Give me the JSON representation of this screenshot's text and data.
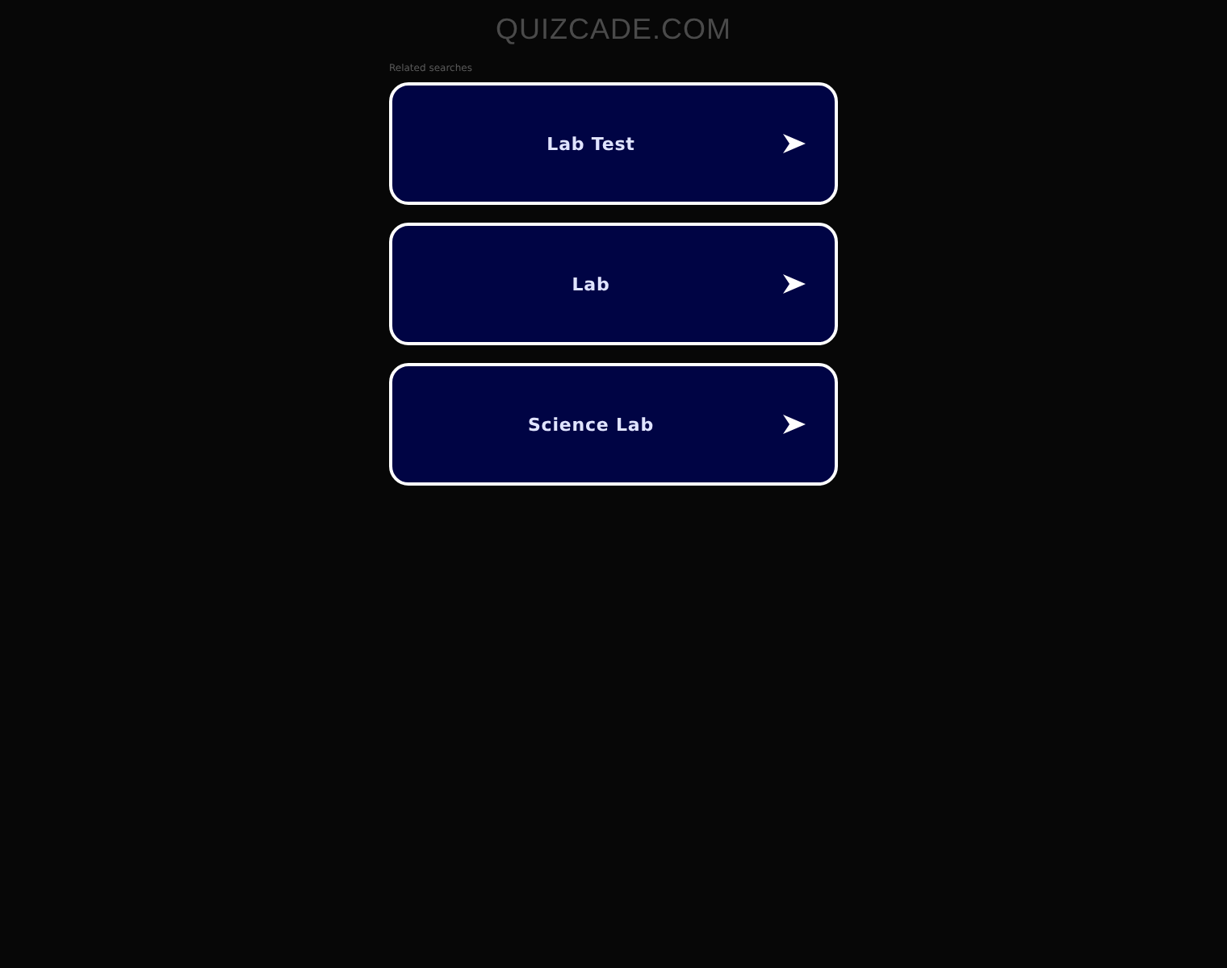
{
  "site_title": "QUIZCADE.COM",
  "related_label": "Related searches",
  "links": [
    {
      "label": "Lab Test"
    },
    {
      "label": "Lab"
    },
    {
      "label": "Science Lab"
    }
  ]
}
